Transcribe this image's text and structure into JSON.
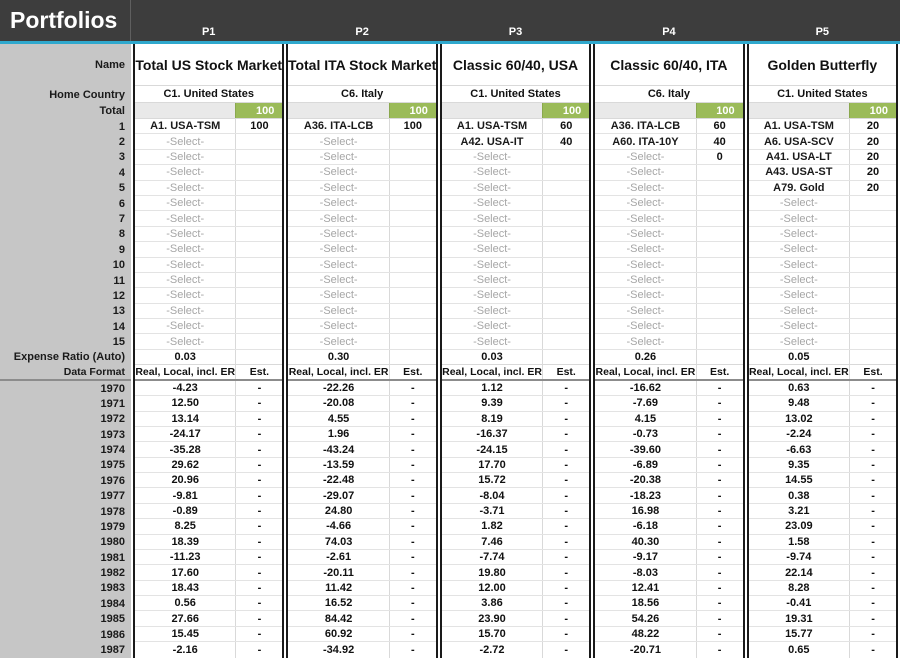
{
  "title": "Portfolios",
  "row_labels": {
    "name": "Name",
    "home_country": "Home Country",
    "total": "Total",
    "asset_rows": [
      "1",
      "2",
      "3",
      "4",
      "5",
      "6",
      "7",
      "8",
      "9",
      "10",
      "11",
      "12",
      "13",
      "14",
      "15"
    ],
    "expense_ratio": "Expense Ratio (Auto)",
    "data_format": "Data Format"
  },
  "years": [
    "1970",
    "1971",
    "1972",
    "1973",
    "1974",
    "1975",
    "1976",
    "1977",
    "1978",
    "1979",
    "1980",
    "1981",
    "1982",
    "1983",
    "1984",
    "1985",
    "1986",
    "1987"
  ],
  "select_placeholder": "-Select-",
  "est_dash": "-",
  "colors": {
    "header_dark": "#3d3d3d",
    "accent_blue": "#2fa8cd",
    "label_gray": "#c6c6c6",
    "total_green": "#9bbb59"
  },
  "portfolios": [
    {
      "id": "P1",
      "name": "Total US Stock Market",
      "home_country": "C1. United States",
      "total": "100",
      "expense_ratio": "0.03",
      "data_format": "Real, Local, incl. ER",
      "est_label": "Est.",
      "assets": [
        {
          "name": "A1. USA-TSM",
          "value": "100"
        },
        {
          "name": "-Select-",
          "value": ""
        },
        {
          "name": "-Select-",
          "value": ""
        },
        {
          "name": "-Select-",
          "value": ""
        },
        {
          "name": "-Select-",
          "value": ""
        },
        {
          "name": "-Select-",
          "value": ""
        },
        {
          "name": "-Select-",
          "value": ""
        },
        {
          "name": "-Select-",
          "value": ""
        },
        {
          "name": "-Select-",
          "value": ""
        },
        {
          "name": "-Select-",
          "value": ""
        },
        {
          "name": "-Select-",
          "value": ""
        },
        {
          "name": "-Select-",
          "value": ""
        },
        {
          "name": "-Select-",
          "value": ""
        },
        {
          "name": "-Select-",
          "value": ""
        },
        {
          "name": "-Select-",
          "value": ""
        }
      ],
      "returns": [
        "-4.23",
        "12.50",
        "13.14",
        "-24.17",
        "-35.28",
        "29.62",
        "20.96",
        "-9.81",
        "-0.89",
        "8.25",
        "18.39",
        "-11.23",
        "17.60",
        "18.43",
        "0.56",
        "27.66",
        "15.45",
        "-2.16"
      ]
    },
    {
      "id": "P2",
      "name": "Total ITA Stock Market",
      "home_country": "C6. Italy",
      "total": "100",
      "expense_ratio": "0.30",
      "data_format": "Real, Local, incl. ER",
      "est_label": "Est.",
      "assets": [
        {
          "name": "A36. ITA-LCB",
          "value": "100"
        },
        {
          "name": "-Select-",
          "value": ""
        },
        {
          "name": "-Select-",
          "value": ""
        },
        {
          "name": "-Select-",
          "value": ""
        },
        {
          "name": "-Select-",
          "value": ""
        },
        {
          "name": "-Select-",
          "value": ""
        },
        {
          "name": "-Select-",
          "value": ""
        },
        {
          "name": "-Select-",
          "value": ""
        },
        {
          "name": "-Select-",
          "value": ""
        },
        {
          "name": "-Select-",
          "value": ""
        },
        {
          "name": "-Select-",
          "value": ""
        },
        {
          "name": "-Select-",
          "value": ""
        },
        {
          "name": "-Select-",
          "value": ""
        },
        {
          "name": "-Select-",
          "value": ""
        },
        {
          "name": "-Select-",
          "value": ""
        }
      ],
      "returns": [
        "-22.26",
        "-20.08",
        "4.55",
        "1.96",
        "-43.24",
        "-13.59",
        "-22.48",
        "-29.07",
        "24.80",
        "-4.66",
        "74.03",
        "-2.61",
        "-20.11",
        "11.42",
        "16.52",
        "84.42",
        "60.92",
        "-34.92"
      ]
    },
    {
      "id": "P3",
      "name": "Classic 60/40, USA",
      "home_country": "C1. United States",
      "total": "100",
      "expense_ratio": "0.03",
      "data_format": "Real, Local, incl. ER",
      "est_label": "Est.",
      "assets": [
        {
          "name": "A1. USA-TSM",
          "value": "60"
        },
        {
          "name": "A42. USA-IT",
          "value": "40"
        },
        {
          "name": "-Select-",
          "value": ""
        },
        {
          "name": "-Select-",
          "value": ""
        },
        {
          "name": "-Select-",
          "value": ""
        },
        {
          "name": "-Select-",
          "value": ""
        },
        {
          "name": "-Select-",
          "value": ""
        },
        {
          "name": "-Select-",
          "value": ""
        },
        {
          "name": "-Select-",
          "value": ""
        },
        {
          "name": "-Select-",
          "value": ""
        },
        {
          "name": "-Select-",
          "value": ""
        },
        {
          "name": "-Select-",
          "value": ""
        },
        {
          "name": "-Select-",
          "value": ""
        },
        {
          "name": "-Select-",
          "value": ""
        },
        {
          "name": "-Select-",
          "value": ""
        }
      ],
      "returns": [
        "1.12",
        "9.39",
        "8.19",
        "-16.37",
        "-24.15",
        "17.70",
        "15.72",
        "-8.04",
        "-3.71",
        "1.82",
        "7.46",
        "-7.74",
        "19.80",
        "12.00",
        "3.86",
        "23.90",
        "15.70",
        "-2.72"
      ]
    },
    {
      "id": "P4",
      "name": "Classic 60/40, ITA",
      "home_country": "C6. Italy",
      "total": "100",
      "expense_ratio": "0.26",
      "data_format": "Real, Local, incl. ER",
      "est_label": "Est.",
      "assets": [
        {
          "name": "A36. ITA-LCB",
          "value": "60"
        },
        {
          "name": "A60. ITA-10Y",
          "value": "40"
        },
        {
          "name": "-Select-",
          "value": "0"
        },
        {
          "name": "-Select-",
          "value": ""
        },
        {
          "name": "-Select-",
          "value": ""
        },
        {
          "name": "-Select-",
          "value": ""
        },
        {
          "name": "-Select-",
          "value": ""
        },
        {
          "name": "-Select-",
          "value": ""
        },
        {
          "name": "-Select-",
          "value": ""
        },
        {
          "name": "-Select-",
          "value": ""
        },
        {
          "name": "-Select-",
          "value": ""
        },
        {
          "name": "-Select-",
          "value": ""
        },
        {
          "name": "-Select-",
          "value": ""
        },
        {
          "name": "-Select-",
          "value": ""
        },
        {
          "name": "-Select-",
          "value": ""
        }
      ],
      "returns": [
        "-16.62",
        "-7.69",
        "4.15",
        "-0.73",
        "-39.60",
        "-6.89",
        "-20.38",
        "-18.23",
        "16.98",
        "-6.18",
        "40.30",
        "-9.17",
        "-8.03",
        "12.41",
        "18.56",
        "54.26",
        "48.22",
        "-20.71"
      ]
    },
    {
      "id": "P5",
      "name": "Golden Butterfly",
      "home_country": "C1. United States",
      "total": "100",
      "expense_ratio": "0.05",
      "data_format": "Real, Local, incl. ER",
      "est_label": "Est.",
      "assets": [
        {
          "name": "A1. USA-TSM",
          "value": "20"
        },
        {
          "name": "A6. USA-SCV",
          "value": "20"
        },
        {
          "name": "A41. USA-LT",
          "value": "20"
        },
        {
          "name": "A43. USA-ST",
          "value": "20"
        },
        {
          "name": "A79. Gold",
          "value": "20"
        },
        {
          "name": "-Select-",
          "value": ""
        },
        {
          "name": "-Select-",
          "value": ""
        },
        {
          "name": "-Select-",
          "value": ""
        },
        {
          "name": "-Select-",
          "value": ""
        },
        {
          "name": "-Select-",
          "value": ""
        },
        {
          "name": "-Select-",
          "value": ""
        },
        {
          "name": "-Select-",
          "value": ""
        },
        {
          "name": "-Select-",
          "value": ""
        },
        {
          "name": "-Select-",
          "value": ""
        },
        {
          "name": "-Select-",
          "value": ""
        }
      ],
      "returns": [
        "0.63",
        "9.48",
        "13.02",
        "-2.24",
        "-6.63",
        "9.35",
        "14.55",
        "0.38",
        "3.21",
        "23.09",
        "1.58",
        "-9.74",
        "22.14",
        "8.28",
        "-0.41",
        "19.31",
        "15.77",
        "0.65"
      ]
    }
  ]
}
